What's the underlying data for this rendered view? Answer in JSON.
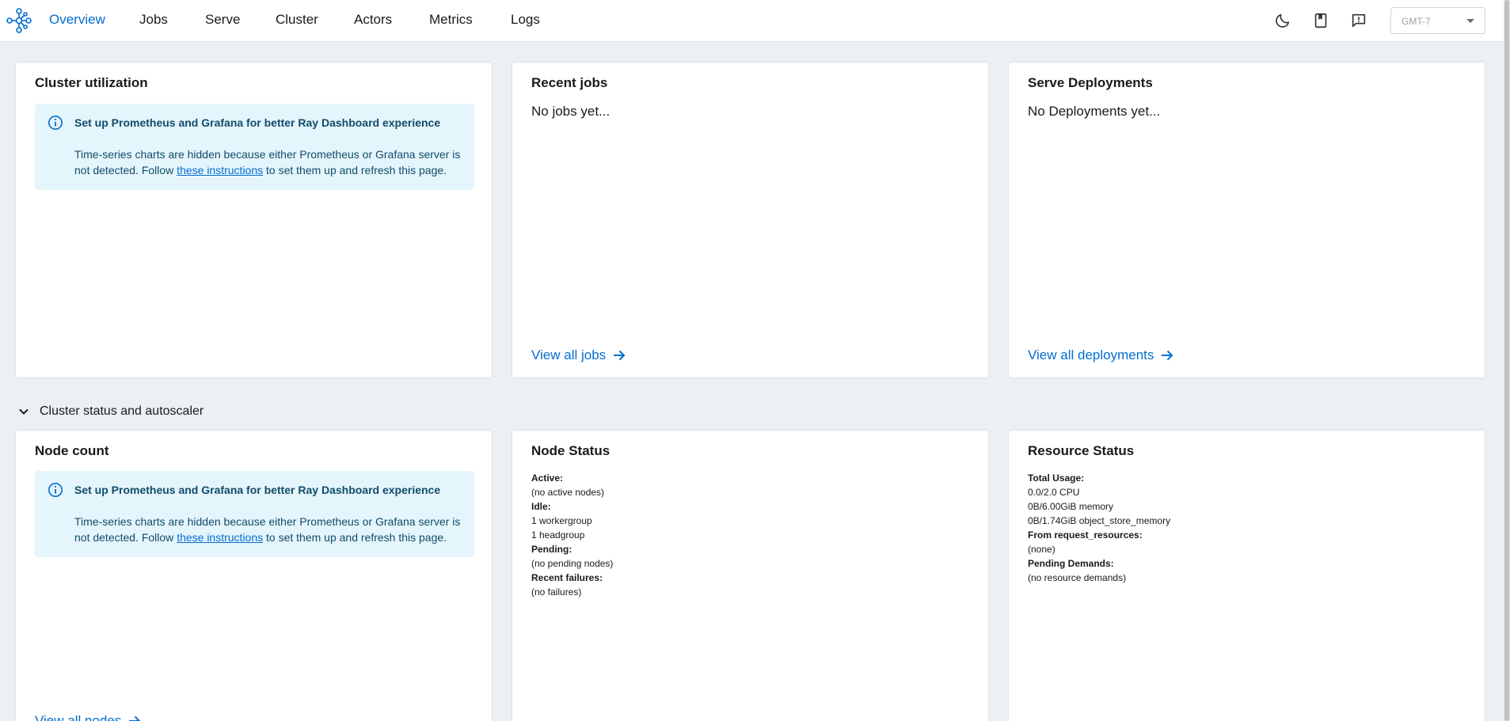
{
  "nav": {
    "items": [
      {
        "label": "Overview",
        "active": true
      },
      {
        "label": "Jobs",
        "active": false
      },
      {
        "label": "Serve",
        "active": false
      },
      {
        "label": "Cluster",
        "active": false
      },
      {
        "label": "Actors",
        "active": false
      },
      {
        "label": "Metrics",
        "active": false
      },
      {
        "label": "Logs",
        "active": false
      }
    ],
    "icons": [
      "moon-icon",
      "docs-book-icon",
      "feedback-icon"
    ],
    "timezone": "GMT-7"
  },
  "cards": {
    "cluster_utilization": {
      "title": "Cluster utilization",
      "alert_title": "Set up Prometheus and Grafana for better Ray Dashboard experience",
      "alert_body_before": "Time-series charts are hidden because either Prometheus or Grafana server is not detected. Follow ",
      "alert_link": "these instructions",
      "alert_body_after": " to set them up and refresh this page."
    },
    "recent_jobs": {
      "title": "Recent jobs",
      "empty": "No jobs yet...",
      "link": "View all jobs"
    },
    "serve_deployments": {
      "title": "Serve Deployments",
      "empty": "No Deployments yet...",
      "link": "View all deployments"
    },
    "node_count": {
      "title": "Node count",
      "alert_title": "Set up Prometheus and Grafana for better Ray Dashboard experience",
      "alert_body_before": "Time-series charts are hidden because either Prometheus or Grafana server is not detected. Follow ",
      "alert_link": "these instructions",
      "alert_body_after": " to set them up and refresh this page.",
      "link": "View all nodes"
    },
    "node_status": {
      "title": "Node Status",
      "lines": [
        {
          "text": "Active:",
          "bold": true
        },
        {
          "text": "(no active nodes)",
          "bold": false
        },
        {
          "text": "Idle:",
          "bold": true
        },
        {
          "text": "1 workergroup",
          "bold": false
        },
        {
          "text": "1 headgroup",
          "bold": false
        },
        {
          "text": "Pending:",
          "bold": true
        },
        {
          "text": "(no pending nodes)",
          "bold": false
        },
        {
          "text": "Recent failures:",
          "bold": true
        },
        {
          "text": "(no failures)",
          "bold": false
        }
      ]
    },
    "resource_status": {
      "title": "Resource Status",
      "lines": [
        {
          "text": "Total Usage:",
          "bold": true
        },
        {
          "text": "0.0/2.0 CPU",
          "bold": false
        },
        {
          "text": "0B/6.00GiB memory",
          "bold": false
        },
        {
          "text": "0B/1.74GiB object_store_memory",
          "bold": false
        },
        {
          "text": "From request_resources:",
          "bold": true
        },
        {
          "text": "(none)",
          "bold": false
        },
        {
          "text": "Pending Demands:",
          "bold": true
        },
        {
          "text": "(no resource demands)",
          "bold": false
        }
      ]
    }
  },
  "section": {
    "label": "Cluster status and autoscaler",
    "expanded": true
  },
  "colors": {
    "accent": "#036dcf",
    "alert_bg": "#e5f5fc",
    "alert_text": "#104c6a",
    "page_bg": "#eceff3"
  }
}
